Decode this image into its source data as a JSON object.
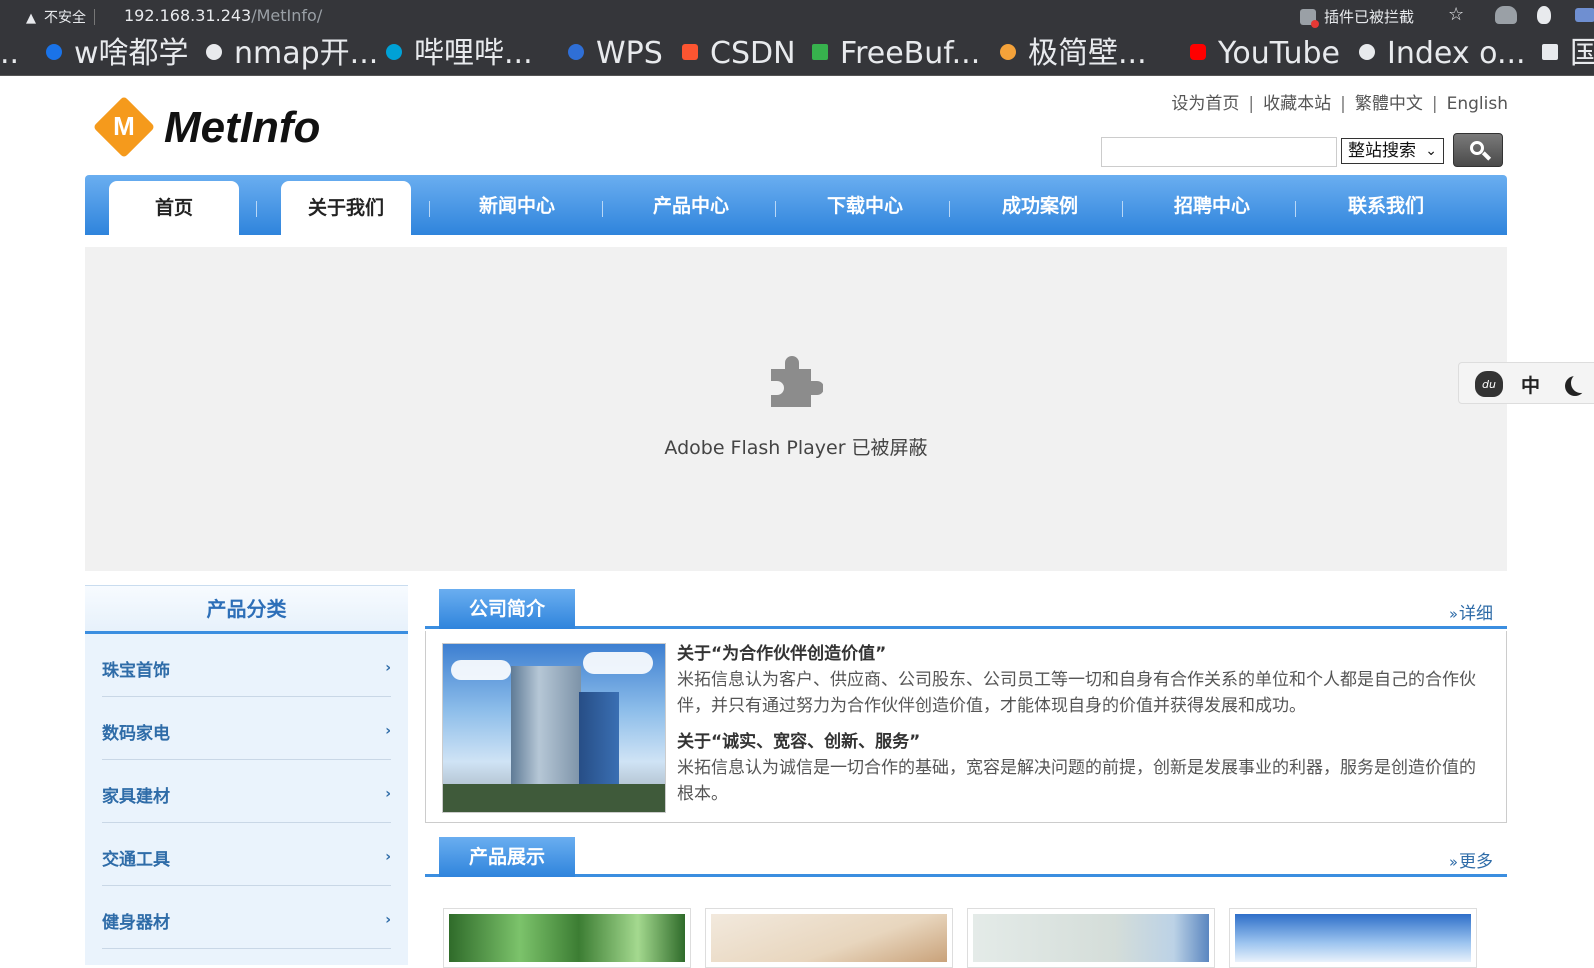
{
  "browser": {
    "security_label": "不安全",
    "url_host": "192.168.31.243",
    "url_path": "/MetInfo/",
    "plugin_blocked": "插件已被拦截",
    "bookmarks_lead": "..",
    "bookmarks": [
      {
        "label": "w啥都学",
        "icon_color": "#1a73e8"
      },
      {
        "label": "nmap开...",
        "icon_color": "#e8eaed"
      },
      {
        "label": "哔哩哔...",
        "icon_color": "#00a1d6"
      },
      {
        "label": "WPS",
        "icon_color": "#2f6fd6"
      },
      {
        "label": "CSDN",
        "icon_color": "#fc5531"
      },
      {
        "label": "FreeBuf...",
        "icon_color": "#37b24d"
      },
      {
        "label": "极简壁...",
        "icon_color": "#f4a23a"
      },
      {
        "label": "YouTube",
        "icon_color": "#ff0000"
      },
      {
        "label": "Index o...",
        "icon_color": "#e8eaed"
      },
      {
        "label": "国",
        "icon_color": "#e8eaed"
      }
    ]
  },
  "header": {
    "logo_letter": "M",
    "logo_text": "MetInfo",
    "toplinks": [
      "设为首页",
      "收藏本站",
      "繁體中文",
      "English"
    ],
    "search_scope": "整站搜索",
    "search_value": ""
  },
  "nav": {
    "items": [
      "首页",
      "关于我们",
      "新闻中心",
      "产品中心",
      "下载中心",
      "成功案例",
      "招聘中心",
      "联系我们"
    ]
  },
  "flash": {
    "message": "Adobe Flash Player 已被屏蔽"
  },
  "sidebar": {
    "title": "产品分类",
    "items": [
      "珠宝首饰",
      "数码家电",
      "家具建材",
      "交通工具",
      "健身器材"
    ]
  },
  "about": {
    "tab": "公司简介",
    "more": "详细",
    "heading1": "关于“为合作伙伴创造价值”",
    "text1": "米拓信息认为客户、供应商、公司股东、公司员工等一切和自身有合作关系的单位和个人都是自己的合作伙伴，并只有通过努力为合作伙伴创造价值，才能体现自身的价值并获得发展和成功。",
    "heading2": "关于“诚实、宽容、创新、服务”",
    "text2": "米拓信息认为诚信是一切合作的基础，宽容是解决问题的前提，创新是发展事业的利器，服务是创造价值的根本。"
  },
  "products": {
    "tab": "产品展示",
    "more": "更多"
  },
  "float_tool": {
    "lang": "中"
  },
  "colors": {
    "nav_blue": "#2f84dc",
    "link_blue": "#2f6ca8",
    "logo_orange": "#f59a1c"
  }
}
